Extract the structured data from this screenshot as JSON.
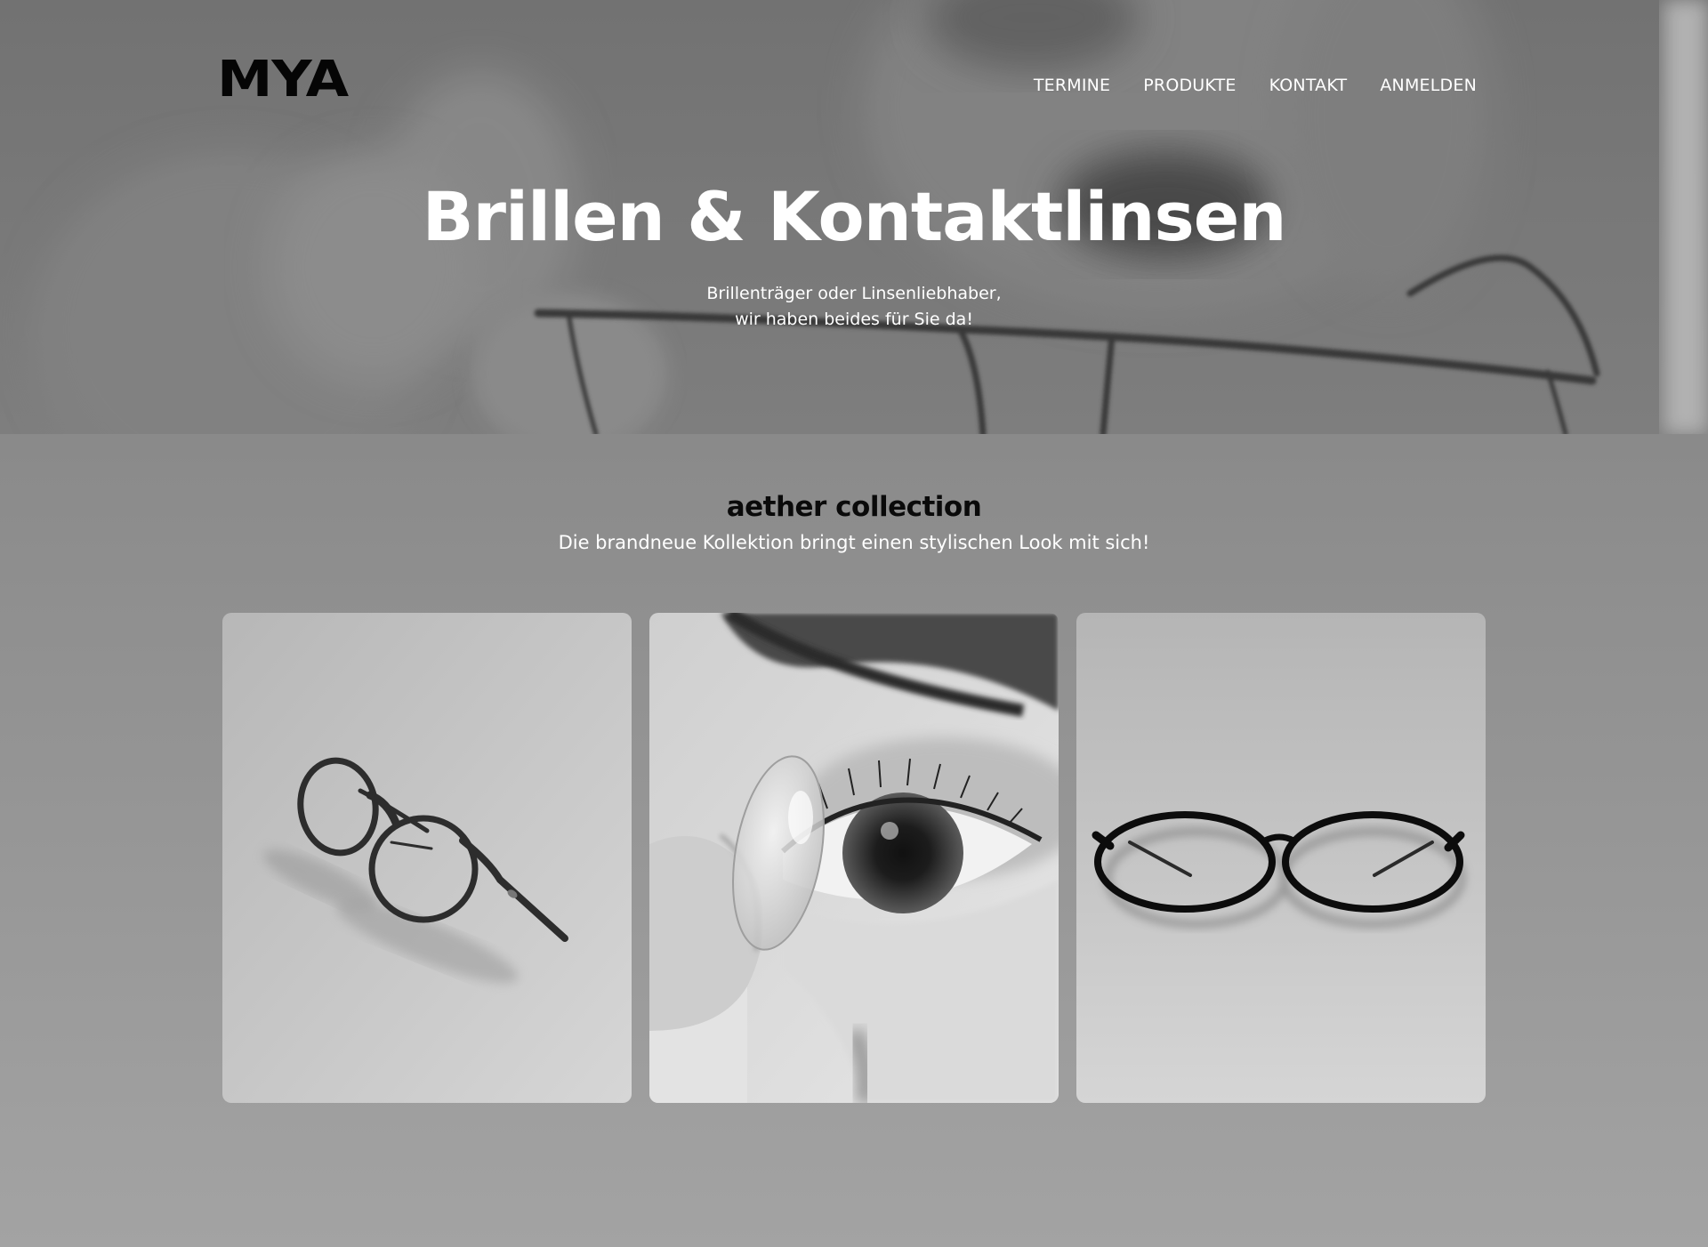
{
  "brand": {
    "logo": "MYA"
  },
  "nav": {
    "items": [
      {
        "label": "TERMINE"
      },
      {
        "label": "PRODUKTE"
      },
      {
        "label": "KONTAKT"
      },
      {
        "label": "ANMELDEN"
      }
    ]
  },
  "hero": {
    "title": "Brillen & Kontaktlinsen",
    "subtitle_line1": "Brillenträger oder Linsenliebhaber,",
    "subtitle_line2": "wir haben beides für Sie da!"
  },
  "collection": {
    "title": "aether collection",
    "subtitle": "Die brandneue Kollektion bringt einen stylischen Look mit sich!",
    "cards": [
      {
        "image": "round-glasses-angled"
      },
      {
        "image": "eye-contact-lens"
      },
      {
        "image": "oval-glasses-front"
      }
    ]
  },
  "colors": {
    "logo": "#050505",
    "text_light": "#ffffff",
    "heading_dark": "#0a0a0a"
  }
}
